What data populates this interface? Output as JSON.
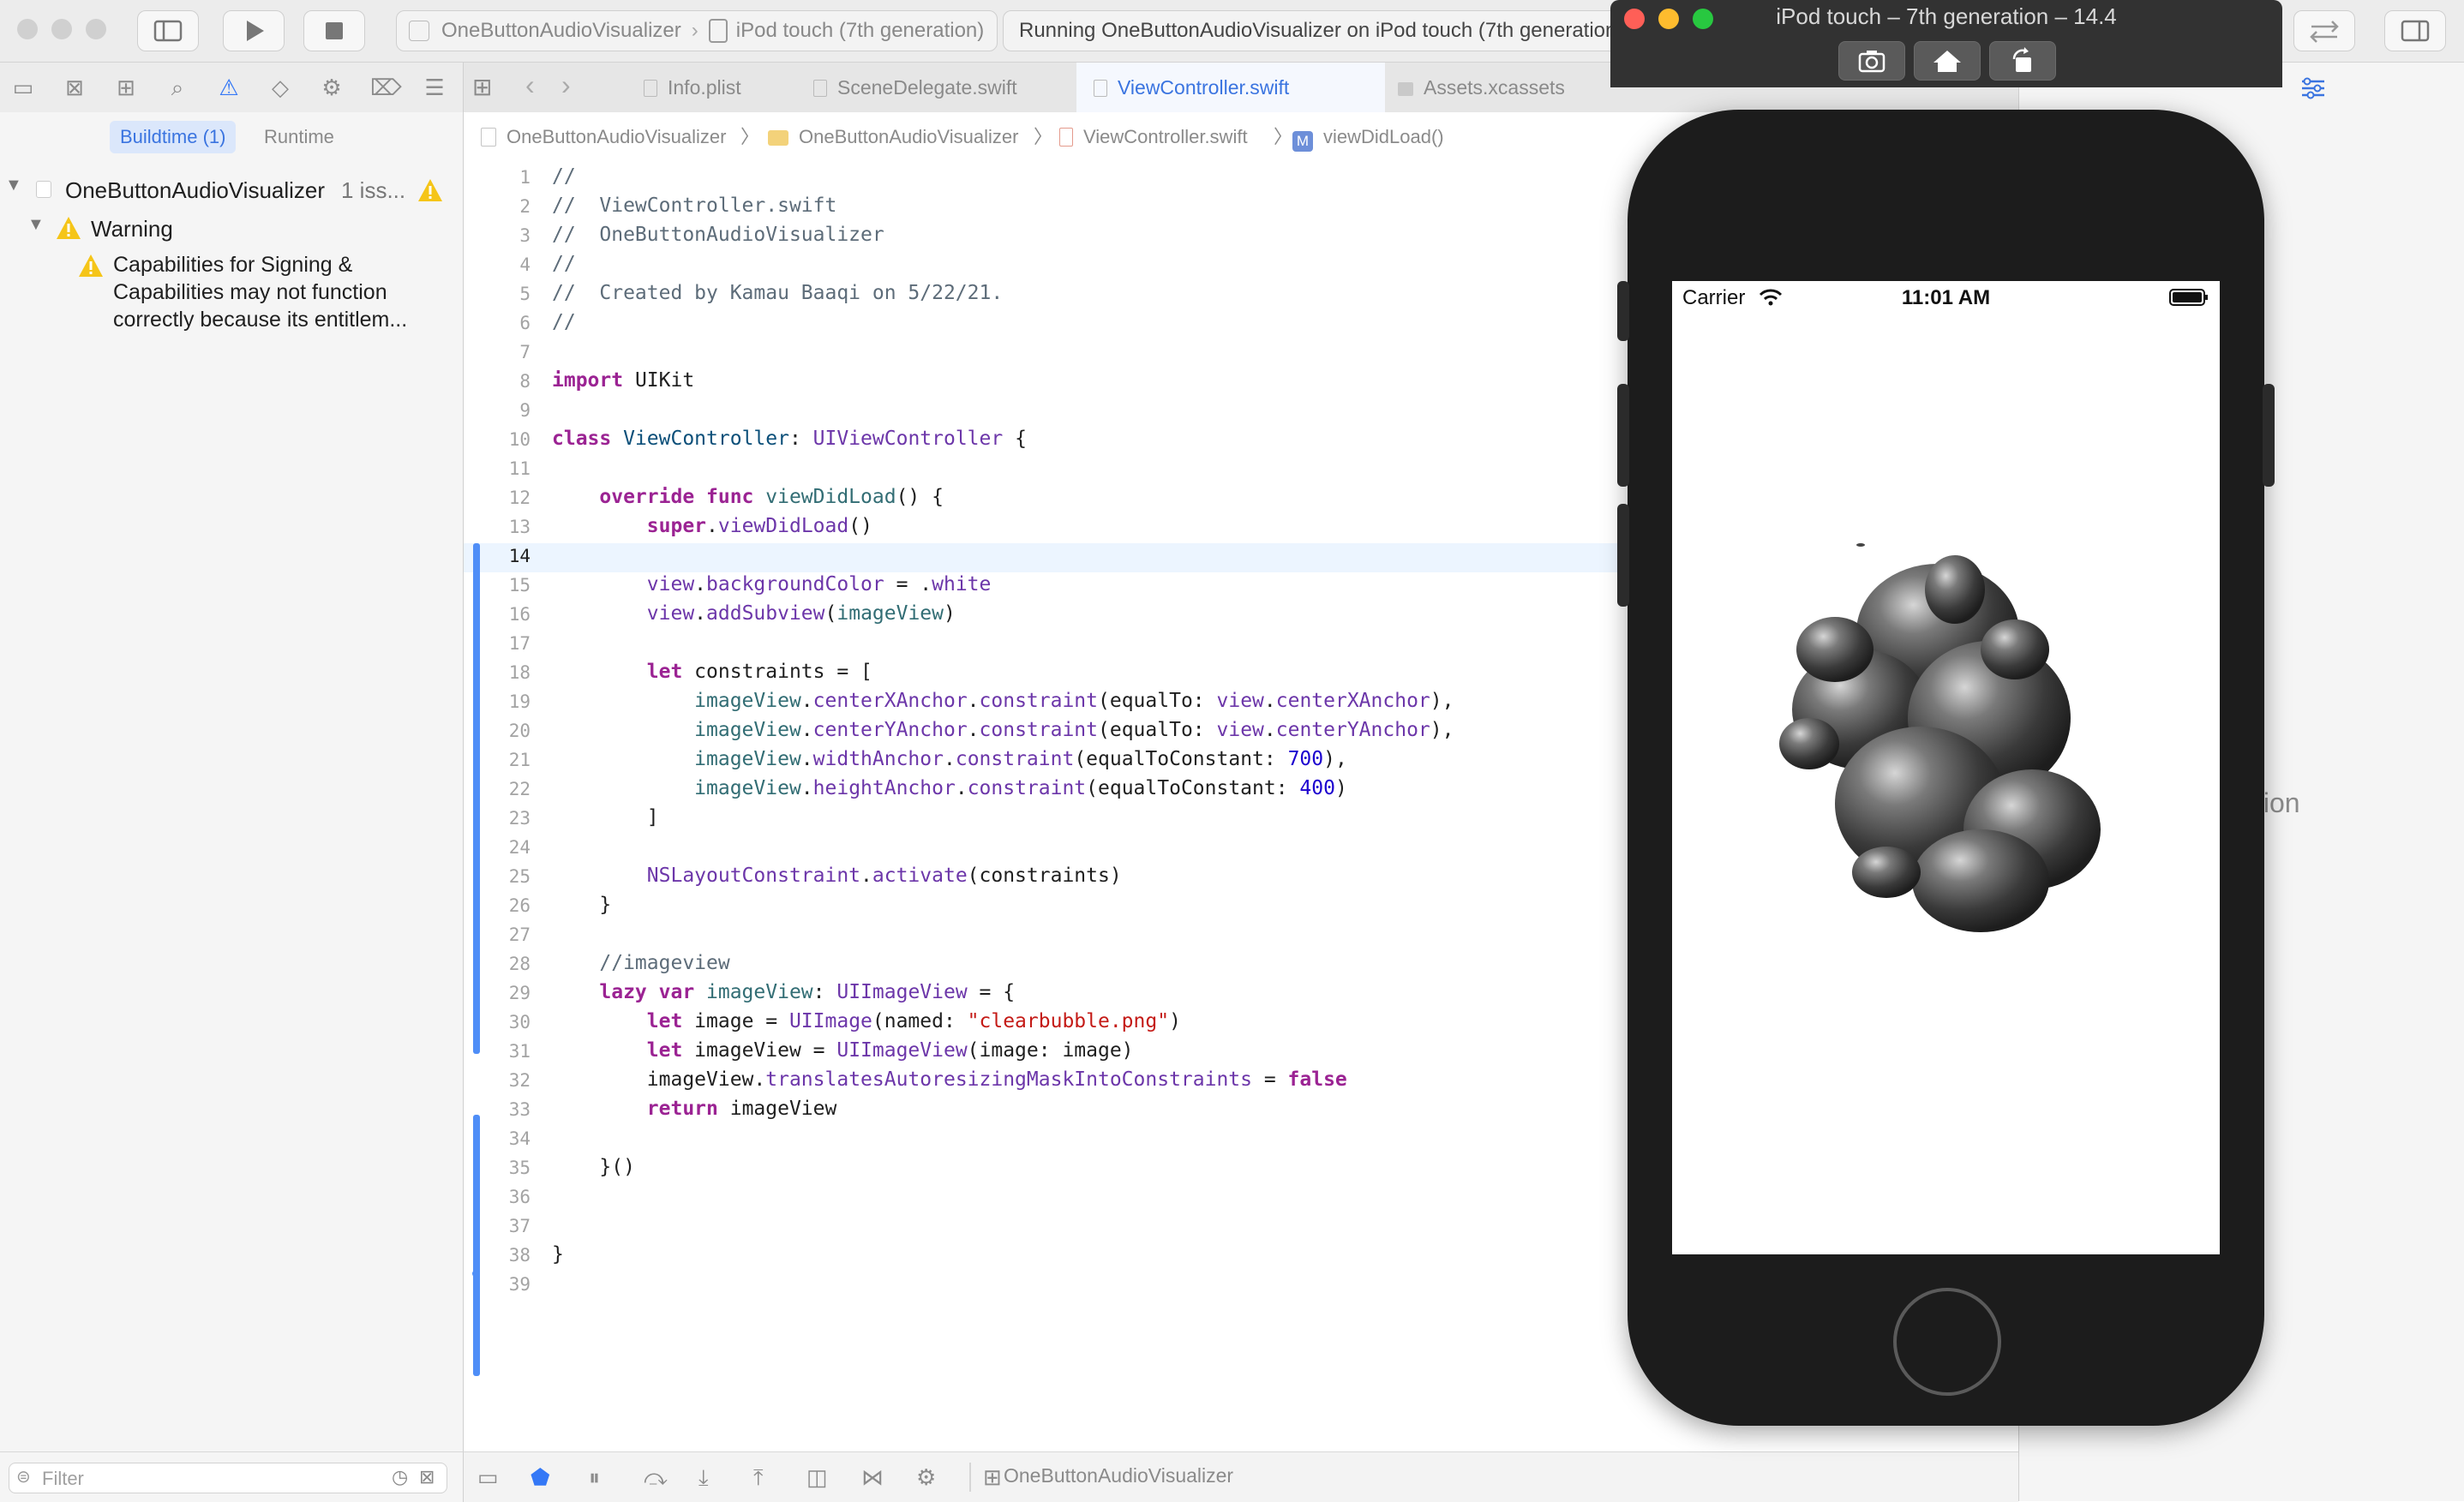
{
  "toolbar": {
    "scheme_project": "OneButtonAudioVisualizer",
    "scheme_device": "iPod touch (7th generation)",
    "status": "Running OneButtonAudioVisualizer on iPod touch (7th generation)"
  },
  "navigator": {
    "segment_buildtime": "Buildtime (1)",
    "segment_runtime": "Runtime",
    "project_name": "OneButtonAudioVisualizer",
    "project_issue_count": "1 iss...",
    "group_label": "Warning",
    "issue_text": "Capabilities for Signing & Capabilities may not function correctly because its entitlem...",
    "filter_placeholder": "Filter"
  },
  "tabs": [
    {
      "label": "Info.plist"
    },
    {
      "label": "SceneDelegate.swift"
    },
    {
      "label": "ViewController.swift"
    },
    {
      "label": "Assets.xcassets"
    }
  ],
  "jumpbar": {
    "project": "OneButtonAudioVisualizer",
    "folder": "OneButtonAudioVisualizer",
    "file": "ViewController.swift",
    "symbol": "viewDidLoad()"
  },
  "editor": {
    "current_line": "14",
    "line_numbers": [
      "1",
      "2",
      "3",
      "4",
      "5",
      "6",
      "7",
      "8",
      "9",
      "10",
      "11",
      "12",
      "13",
      "14",
      "15",
      "16",
      "17",
      "18",
      "19",
      "20",
      "21",
      "22",
      "23",
      "24",
      "25",
      "26",
      "27",
      "28",
      "29",
      "30",
      "31",
      "32",
      "33",
      "34",
      "35",
      "36",
      "37",
      "38",
      "39"
    ],
    "code": {
      "l1": "//",
      "l2": "//  ViewController.swift",
      "l3": "//  OneButtonAudioVisualizer",
      "l4": "//",
      "l5": "//  Created by Kamau Baaqi on 5/22/21.",
      "l6": "//",
      "l8_kw": "import",
      "l8_rest": " UIKit",
      "l10_kw": "class",
      "l10_name": " ViewController",
      "l10_mid": ": ",
      "l10_type": "UIViewController",
      "l10_end": " {",
      "l12_kw": "override func",
      "l12_fn": " viewDidLoad",
      "l12_end": "() {",
      "l13_kw": "super",
      "l13_rest": ".",
      "l13_fn": "viewDidLoad",
      "l13_end": "()",
      "l15_a": "view",
      "l15_b": ".",
      "l15_c": "backgroundColor",
      "l15_d": " = .",
      "l15_e": "white",
      "l16_a": "view",
      "l16_b": ".",
      "l16_c": "addSubview",
      "l16_d": "(",
      "l16_e": "imageView",
      "l16_f": ")",
      "l18_kw": "let",
      "l18_rest": " constraints = [",
      "l19_a": "imageView",
      "l19_b": ".",
      "l19_c": "centerXAnchor",
      "l19_d": ".",
      "l19_e": "constraint",
      "l19_f": "(equalTo: ",
      "l19_g": "view",
      "l19_h": ".",
      "l19_i": "centerXAnchor",
      "l19_j": "),",
      "l20_a": "imageView",
      "l20_b": ".",
      "l20_c": "centerYAnchor",
      "l20_d": ".",
      "l20_e": "constraint",
      "l20_f": "(equalTo: ",
      "l20_g": "view",
      "l20_h": ".",
      "l20_i": "centerYAnchor",
      "l20_j": "),",
      "l21_a": "imageView",
      "l21_b": ".",
      "l21_c": "widthAnchor",
      "l21_d": ".",
      "l21_e": "constraint",
      "l21_f": "(equalToConstant: ",
      "l21_g": "700",
      "l21_h": "),",
      "l22_a": "imageView",
      "l22_b": ".",
      "l22_c": "heightAnchor",
      "l22_d": ".",
      "l22_e": "constraint",
      "l22_f": "(equalToConstant: ",
      "l22_g": "400",
      "l22_h": ")",
      "l23": "]",
      "l25_a": "NSLayoutConstraint",
      "l25_b": ".",
      "l25_c": "activate",
      "l25_d": "(constraints)",
      "l26": "}",
      "l28": "//imageview",
      "l29_kw": "lazy var",
      "l29_name": " imageView",
      "l29_mid": ": ",
      "l29_type": "UIImageView",
      "l29_end": " = {",
      "l30_kw": "let",
      "l30_a": " image = ",
      "l30_b": "UIImage",
      "l30_c": "(named: ",
      "l30_d": "\"clearbubble.png\"",
      "l30_e": ")",
      "l31_kw": "let",
      "l31_a": " imageView = ",
      "l31_b": "UIImageView",
      "l31_c": "(image: image)",
      "l32_a": "imageView.",
      "l32_b": "translatesAutoresizingMaskIntoConstraints",
      "l32_c": " = ",
      "l32_d": "false",
      "l33_kw": "return",
      "l33_rest": " imageView",
      "l35": "}()",
      "l38": "}"
    }
  },
  "debugbar": {
    "target": "OneButtonAudioVisualizer"
  },
  "inspector": {
    "partial_text": "ction"
  },
  "simulator": {
    "title": "iPod touch – 7th generation – 14.4",
    "carrier": "Carrier",
    "time": "11:01 AM"
  },
  "colors": {
    "accent": "#4f8ef7",
    "warning": "#f5c518",
    "keyword": "#9b2393",
    "string": "#c41a16",
    "number": "#1c00cf"
  }
}
